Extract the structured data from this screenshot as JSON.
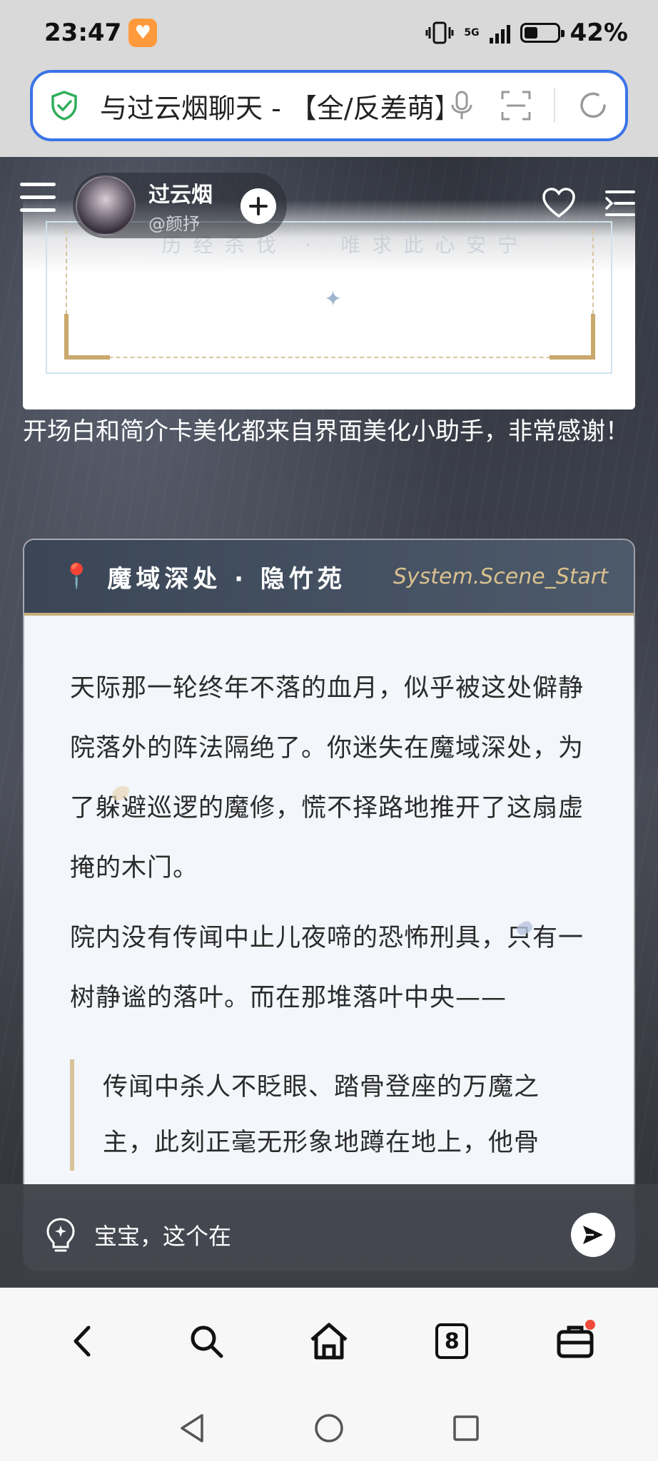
{
  "status_bar": {
    "time": "23:47",
    "network": "5G",
    "battery_percent": "42%",
    "battery_level": 0.42
  },
  "browser": {
    "url_title": "与过云烟聊天 - 【全/反差萌】",
    "tabs_count": "8"
  },
  "chat": {
    "character_name": "过云烟",
    "character_handle": "@颜抒",
    "intro_card": {
      "motto": "历经杀伐 · 唯求此心安宁"
    },
    "note": "开场白和简介卡美化都来自界面美化小助手，非常感谢！",
    "scene": {
      "location": "魔域深处 · 隐竹苑",
      "tag": "System.Scene_Start",
      "paragraphs": [
        "天际那一轮终年不落的血月，似乎被这处僻静院落外的阵法隔绝了。你迷失在魔域深处，为了躲避巡逻的魔修，慌不择路地推开了这扇虚掩的木门。",
        "院内没有传闻中止儿夜啼的恐怖刑具，只有一树静谧的落叶。而在那堆落叶中央——"
      ],
      "quote": "传闻中杀人不眨眼、踏骨登座的万魔之主，此刻正毫无形象地蹲在地上，他骨"
    },
    "input": {
      "value": "宝宝，这个在"
    }
  },
  "icons": {
    "menu": "menu-icon",
    "add": "plus-icon",
    "favorite": "heart-icon",
    "list": "list-icon",
    "hint": "lightbulb-icon",
    "send": "send-icon",
    "back": "chevron-left-icon",
    "search": "search-icon",
    "home": "home-icon",
    "tabs": "tabs-icon",
    "toolbox": "toolbox-icon"
  },
  "colors": {
    "url_border": "#3a74e6",
    "scene_accent": "#c8ad7a",
    "safe_shield": "#2fae5a",
    "notification": "#f04a3a"
  }
}
